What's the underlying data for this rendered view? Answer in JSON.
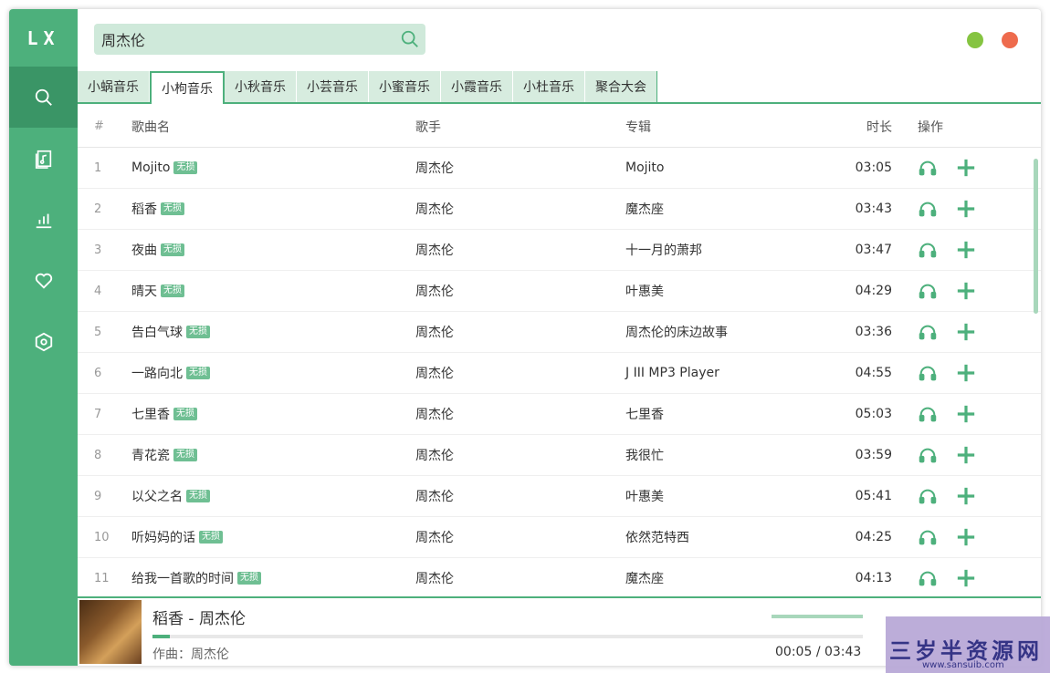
{
  "app": {
    "logo": "LX"
  },
  "search": {
    "value": "周杰伦"
  },
  "sidebar": {
    "items": [
      {
        "icon": "search-icon"
      },
      {
        "icon": "music-file-icon"
      },
      {
        "icon": "chart-icon"
      },
      {
        "icon": "heart-icon"
      },
      {
        "icon": "settings-icon"
      }
    ]
  },
  "tabs": [
    "小蜗音乐",
    "小枸音乐",
    "小秋音乐",
    "小芸音乐",
    "小蜜音乐",
    "小霞音乐",
    "小杜音乐",
    "聚合大会"
  ],
  "active_tab": 1,
  "table": {
    "headers": {
      "num": "#",
      "name": "歌曲名",
      "singer": "歌手",
      "album": "专辑",
      "duration": "时长",
      "ops": "操作"
    },
    "badge": "无损",
    "rows": [
      {
        "num": "1",
        "name": "Mojito",
        "singer": "周杰伦",
        "album": "Mojito",
        "duration": "03:05"
      },
      {
        "num": "2",
        "name": "稻香",
        "singer": "周杰伦",
        "album": "魔杰座",
        "duration": "03:43"
      },
      {
        "num": "3",
        "name": "夜曲",
        "singer": "周杰伦",
        "album": "十一月的萧邦",
        "duration": "03:47"
      },
      {
        "num": "4",
        "name": "晴天",
        "singer": "周杰伦",
        "album": "叶惠美",
        "duration": "04:29"
      },
      {
        "num": "5",
        "name": "告白气球",
        "singer": "周杰伦",
        "album": "周杰伦的床边故事",
        "duration": "03:36"
      },
      {
        "num": "6",
        "name": "一路向北",
        "singer": "周杰伦",
        "album": "J III MP3 Player",
        "duration": "04:55"
      },
      {
        "num": "7",
        "name": "七里香",
        "singer": "周杰伦",
        "album": "七里香",
        "duration": "05:03"
      },
      {
        "num": "8",
        "name": "青花瓷",
        "singer": "周杰伦",
        "album": "我很忙",
        "duration": "03:59"
      },
      {
        "num": "9",
        "name": "以父之名",
        "singer": "周杰伦",
        "album": "叶惠美",
        "duration": "05:41"
      },
      {
        "num": "10",
        "name": "听妈妈的话",
        "singer": "周杰伦",
        "album": "依然范特西",
        "duration": "04:25"
      },
      {
        "num": "11",
        "name": "给我一首歌的时间",
        "singer": "周杰伦",
        "album": "魔杰座",
        "duration": "04:13"
      }
    ]
  },
  "player": {
    "title": "稻香 - 周杰伦",
    "lyric": "作曲：周杰伦",
    "current": "00:05",
    "separator": "/",
    "total": "03:43",
    "progress_fraction": 0.024,
    "volume_fraction": 1.0
  },
  "watermark": {
    "text": "三岁半资源网",
    "url": "www.sansuib.com"
  },
  "colors": {
    "accent": "#4db07c",
    "minimize": "#85c441",
    "close": "#ee6b4d"
  }
}
